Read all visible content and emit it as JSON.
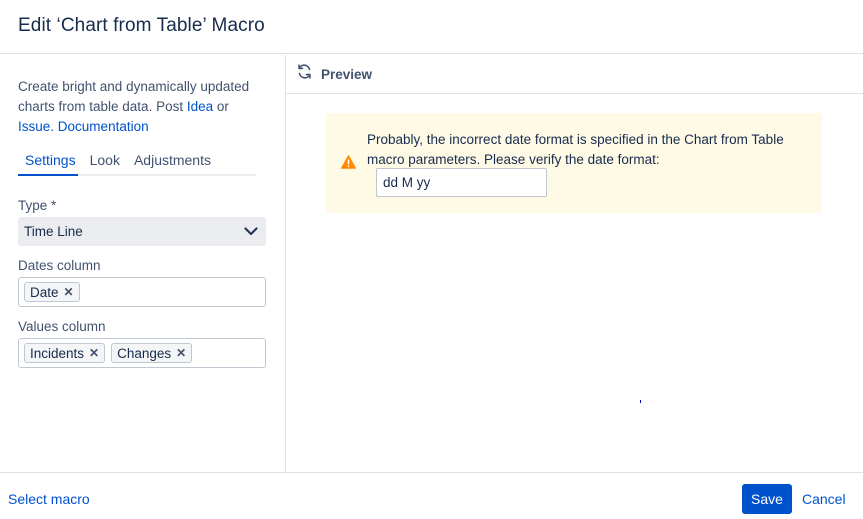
{
  "dialog": {
    "title": "Edit ‘Chart from Table’ Macro"
  },
  "sidebar": {
    "description_text": "Create bright and dynamically updated charts from table data. Post ",
    "link_idea": "Idea",
    "or_text": " or ",
    "link_issue": "Issue",
    "period_text": ". ",
    "link_documentation": "Documentation",
    "tabs": [
      {
        "label": "Settings",
        "active": true
      },
      {
        "label": "Look",
        "active": false
      },
      {
        "label": "Adjustments",
        "active": false
      }
    ],
    "type_label": "Type *",
    "type_value": "Time Line",
    "dates_label": "Dates column",
    "dates_tags": [
      "Date"
    ],
    "values_label": "Values column",
    "values_tags": [
      "Incidents",
      "Changes"
    ]
  },
  "preview": {
    "label": "Preview",
    "icon": "refresh-icon",
    "warning_icon": "warning-icon",
    "warning_color": "#ff8b00",
    "warning_message": "Probably, the incorrect date format is specified in the Chart from Table macro parameters. Please verify the date format:",
    "date_format_value": "dd M yy"
  },
  "footer": {
    "select_macro_label": "Select macro",
    "save_label": "Save",
    "cancel_label": "Cancel"
  },
  "colors": {
    "accent": "#0052cc",
    "warning_bg": "#fffae6",
    "text": "#172b4d"
  }
}
